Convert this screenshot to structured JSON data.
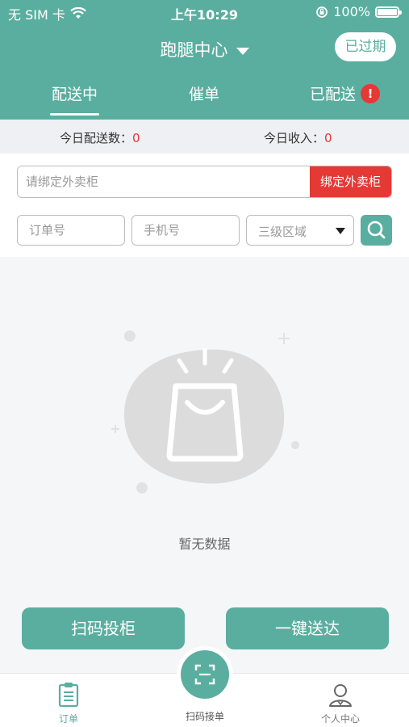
{
  "status_bar": {
    "carrier": "无 SIM 卡",
    "time": "上午10:29",
    "battery": "100%"
  },
  "header": {
    "title": "跑腿中心",
    "expired_label": "已过期"
  },
  "tabs": [
    {
      "label": "配送中",
      "active": true
    },
    {
      "label": "催单",
      "active": false
    },
    {
      "label": "已配送",
      "active": false,
      "badge": "!"
    }
  ],
  "stats": {
    "delivered_label": "今日配送数：",
    "delivered_value": "0",
    "income_label": "今日收入：",
    "income_value": "0"
  },
  "bind": {
    "placeholder": "请绑定外卖柜",
    "button_label": "绑定外卖柜"
  },
  "filters": {
    "order_placeholder": "订单号",
    "phone_placeholder": "手机号",
    "region_value": "三级区域"
  },
  "empty": {
    "text": "暂无数据"
  },
  "actions": {
    "scan_cabinet": "扫码投柜",
    "one_click_deliver": "一键送达"
  },
  "tabbar": {
    "orders": "订单",
    "scan_order": "扫码接单",
    "profile": "个人中心"
  },
  "colors": {
    "primary": "#5aae9f",
    "danger": "#e53935",
    "background": "#f5f6f8"
  }
}
